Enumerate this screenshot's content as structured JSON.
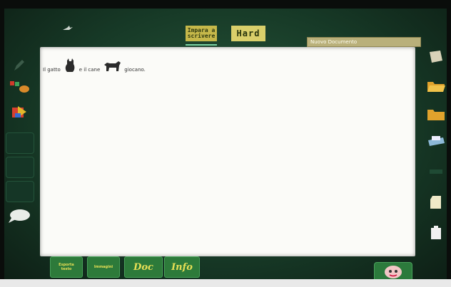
{
  "topbar": {
    "mode_simple_line1": "Impara a",
    "mode_simple_line2": "scrivere",
    "mode_hard_label": "Hard",
    "document_name": "Nuovo Documento"
  },
  "document": {
    "text_part1": "Il gatto",
    "text_part2": "e il cane",
    "text_part3": "giocano."
  },
  "bottombar": {
    "button1_line1": "Esporta",
    "button1_line2": "testo",
    "button2_label": "Immagini",
    "button3_label": "Doc",
    "button4_label": "Info"
  },
  "icons": {
    "left": [
      "pencil-icon",
      "colors-icon",
      "shapes-icon",
      "blank-tool-icon",
      "blank-tool-icon",
      "blank-tool-icon",
      "speech-bubble-icon"
    ],
    "right": [
      "scroll-icon",
      "folder-open-icon",
      "folder-icon",
      "print-icon",
      "eraser-icon",
      "copy-icon",
      "paste-icon"
    ],
    "help": "help-face-icon"
  },
  "colors": {
    "accent_yellow": "#e7df55",
    "panel_green": "#2d7a3a",
    "document_white": "#fbfbf8"
  }
}
